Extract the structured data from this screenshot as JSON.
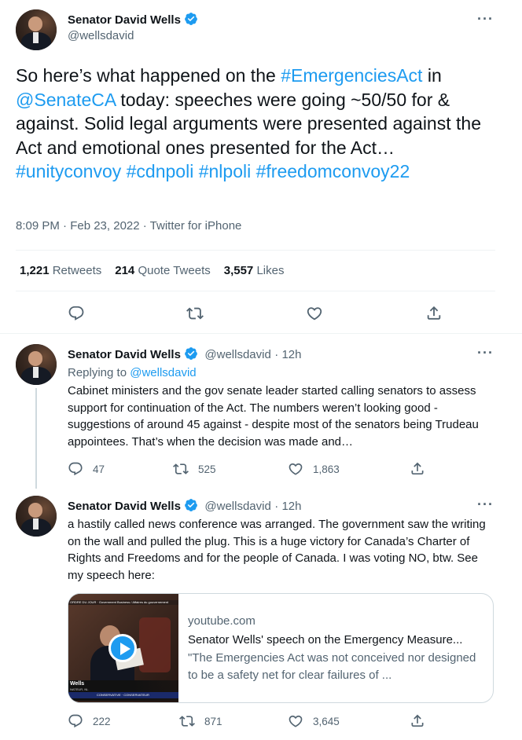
{
  "main_tweet": {
    "author": {
      "name": "Senator David Wells",
      "handle": "@wellsdavid"
    },
    "more_label": "···",
    "text_segments": [
      {
        "t": "So here’s what happened on the ",
        "link": false
      },
      {
        "t": "#EmergenciesAct",
        "link": true
      },
      {
        "t": " in ",
        "link": false
      },
      {
        "t": "@SenateCA",
        "link": true
      },
      {
        "t": " today: speeches were going ~50/50 for & against. Solid legal arguments were presented against the Act and emotional ones presented for the Act…",
        "link": false
      },
      {
        "t": "#unityconvoy",
        "link": true
      },
      {
        "t": " ",
        "link": false
      },
      {
        "t": "#cdnpoli",
        "link": true
      },
      {
        "t": " ",
        "link": false
      },
      {
        "t": "#nlpoli",
        "link": true
      },
      {
        "t": " ",
        "link": false
      },
      {
        "t": "#freedomconvoy22",
        "link": true
      }
    ],
    "meta": "8:09 PM · Feb 23, 2022 · Twitter for iPhone",
    "stats": {
      "retweets_count": "1,221",
      "retweets_label": "Retweets",
      "quotes_count": "214",
      "quotes_label": "Quote Tweets",
      "likes_count": "3,557",
      "likes_label": "Likes"
    }
  },
  "replies": [
    {
      "name": "Senator David Wells",
      "handle": "@wellsdavid",
      "time": "· 12h",
      "replying_prefix": "Replying to ",
      "replying_handle": "@wellsdavid",
      "text": "Cabinet ministers and the gov senate leader started calling senators to assess support for continuation of the Act. The numbers weren’t looking good - suggestions of around 45 against - despite most of the senators being Trudeau appointees. That’s when the decision was made and…",
      "replies": "47",
      "retweets": "525",
      "likes": "1,863"
    },
    {
      "name": "Senator David Wells",
      "handle": "@wellsdavid",
      "time": "· 12h",
      "text": "a hastily called news conference was arranged. The government saw the writing on the wall and pulled the plug. This is a huge victory for Canada’s Charter of Rights and Freedoms and for the people of Canada. I was voting NO, btw. See my speech here:",
      "card": {
        "domain": "youtube.com",
        "title": "Senator Wells' speech on the Emergency Measure...",
        "description": "\"The Emergencies Act was not conceived nor designed to be a safety net for clear failures of ...",
        "media_banner": "ORDRE DU JOUR · Government Business / Affaires du gouvernement",
        "media_name": "Wells",
        "media_sub": "NATEUR, NL",
        "media_tag": "CONSERVATIVE · CONSERVATEUR"
      },
      "replies": "222",
      "retweets": "871",
      "likes": "3,645"
    }
  ],
  "colors": {
    "link": "#1d9bf0",
    "secondary": "#536471",
    "text": "#0f1419",
    "divider": "#eff3f4"
  },
  "icons": [
    "verified-badge-icon",
    "more-icon",
    "reply-icon",
    "retweet-icon",
    "like-icon",
    "share-icon",
    "play-icon"
  ]
}
